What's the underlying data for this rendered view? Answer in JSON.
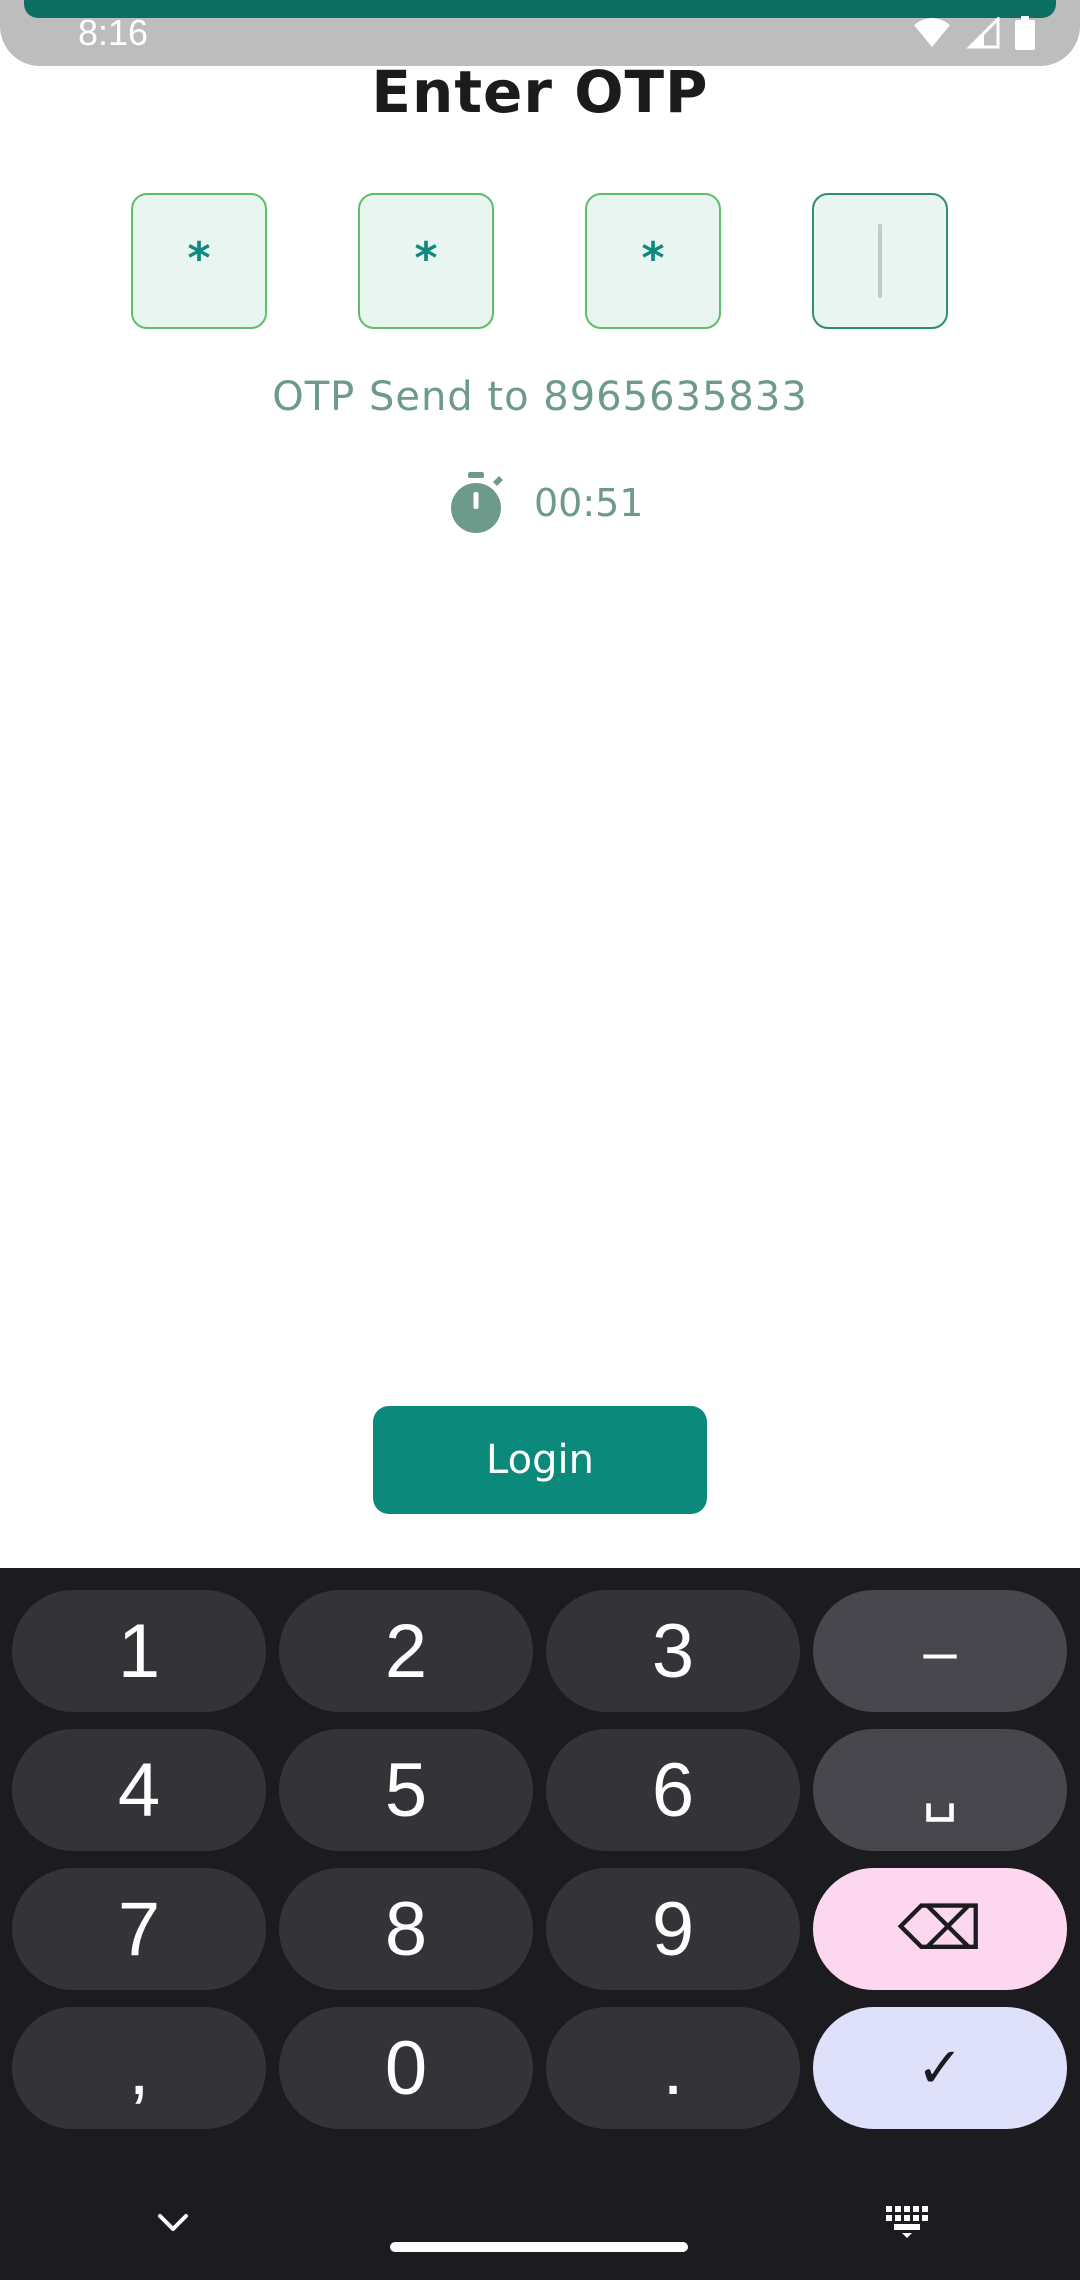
{
  "status_bar": {
    "time": "8:16"
  },
  "page": {
    "title": "Enter OTP",
    "otp_digits": [
      "*",
      "*",
      "*",
      ""
    ],
    "otp_sent_text": "OTP Send to 8965635833",
    "timer": "00:51",
    "login_label": "Login"
  },
  "keyboard": {
    "keys": [
      "1",
      "2",
      "3",
      "–",
      "4",
      "5",
      "6",
      "␣",
      "7",
      "8",
      "9",
      "⌫",
      ",",
      "0",
      ".",
      "✓"
    ]
  },
  "colors": {
    "accent": "#0b897b",
    "otp_fill": "#e8f5f1",
    "otp_border": "#5cbf6a",
    "muted_text": "#6e9a8c",
    "keyboard_bg": "#1c1b20",
    "key_bg": "#343438",
    "delete_key_bg": "#fcd7ef",
    "done_key_bg": "#dfe0fa"
  }
}
